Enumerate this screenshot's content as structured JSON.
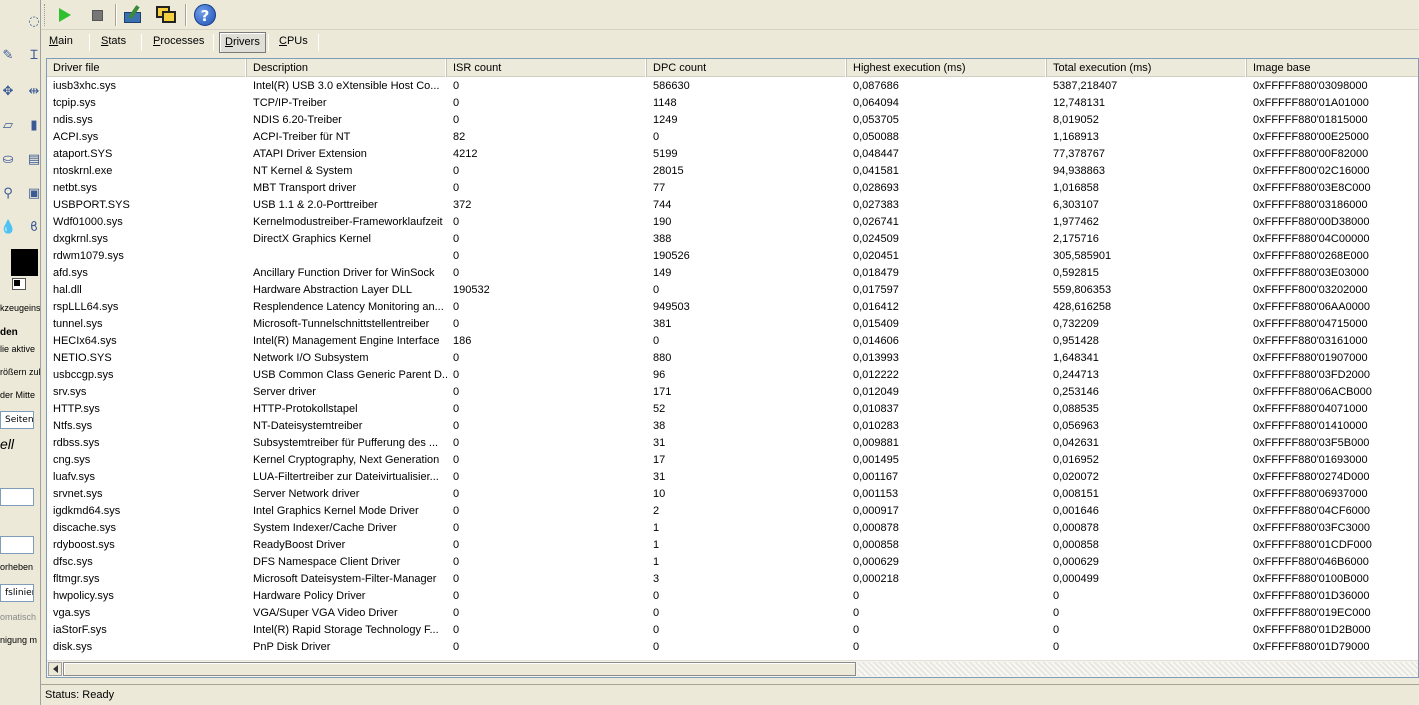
{
  "left_strip": {
    "texts": [
      "kzeugeins",
      "den",
      "lie aktive",
      "rößern zul",
      "der Mitte",
      "ell",
      "orheben",
      "fslinien",
      "omatisch",
      "nigung m"
    ],
    "box_texts": [
      "Seitenv"
    ]
  },
  "toolbar": {
    "buttons": [
      {
        "name": "start-monitor-button",
        "icon": "play-icon"
      },
      {
        "name": "stop-monitor-button",
        "icon": "stop-icon"
      },
      {
        "name": "tools-button",
        "icon": "tools-icon"
      },
      {
        "name": "window-button",
        "icon": "windows-icon"
      },
      {
        "name": "help-button",
        "icon": "help-icon",
        "glyph": "?"
      }
    ]
  },
  "tabs": [
    {
      "label": "Main",
      "accel": "M",
      "rest": "ain",
      "active": false
    },
    {
      "label": "Stats",
      "accel": "S",
      "rest": "tats",
      "active": false
    },
    {
      "label": "Processes",
      "accel": "P",
      "rest": "rocesses",
      "active": false
    },
    {
      "label": "Drivers",
      "accel": "D",
      "rest": "rivers",
      "active": true
    },
    {
      "label": "CPUs",
      "accel": "C",
      "rest": "PUs",
      "active": false
    }
  ],
  "table": {
    "columns": [
      "Driver file",
      "Description",
      "ISR count",
      "DPC count",
      "Highest execution (ms)",
      "Total execution (ms)",
      "Image base"
    ],
    "rows": [
      [
        "iusb3xhc.sys",
        "Intel(R) USB 3.0 eXtensible Host Co...",
        "0",
        "586630",
        "0,087686",
        "5387,218407",
        "0xFFFFF880'03098000"
      ],
      [
        "tcpip.sys",
        "TCP/IP-Treiber",
        "0",
        "1148",
        "0,064094",
        "12,748131",
        "0xFFFFF880'01A01000"
      ],
      [
        "ndis.sys",
        "NDIS 6.20-Treiber",
        "0",
        "1249",
        "0,053705",
        "8,019052",
        "0xFFFFF880'01815000"
      ],
      [
        "ACPI.sys",
        "ACPI-Treiber für NT",
        "82",
        "0",
        "0,050088",
        "1,168913",
        "0xFFFFF880'00E25000"
      ],
      [
        "ataport.SYS",
        "ATAPI Driver Extension",
        "4212",
        "5199",
        "0,048447",
        "77,378767",
        "0xFFFFF880'00F82000"
      ],
      [
        "ntoskrnl.exe",
        "NT Kernel & System",
        "0",
        "28015",
        "0,041581",
        "94,938863",
        "0xFFFFF800'02C16000"
      ],
      [
        "netbt.sys",
        "MBT Transport driver",
        "0",
        "77",
        "0,028693",
        "1,016858",
        "0xFFFFF880'03E8C000"
      ],
      [
        "USBPORT.SYS",
        "USB 1.1 & 2.0-Porttreiber",
        "372",
        "744",
        "0,027383",
        "6,303107",
        "0xFFFFF880'03186000"
      ],
      [
        "Wdf01000.sys",
        "Kernelmodustreiber-Frameworklaufzeit",
        "0",
        "190",
        "0,026741",
        "1,977462",
        "0xFFFFF880'00D38000"
      ],
      [
        "dxgkrnl.sys",
        "DirectX Graphics Kernel",
        "0",
        "388",
        "0,024509",
        "2,175716",
        "0xFFFFF880'04C00000"
      ],
      [
        "rdwm1079.sys",
        "",
        "0",
        "190526",
        "0,020451",
        "305,585901",
        "0xFFFFF880'0268E000"
      ],
      [
        "afd.sys",
        "Ancillary Function Driver for WinSock",
        "0",
        "149",
        "0,018479",
        "0,592815",
        "0xFFFFF880'03E03000"
      ],
      [
        "hal.dll",
        "Hardware Abstraction Layer DLL",
        "190532",
        "0",
        "0,017597",
        "559,806353",
        "0xFFFFF800'03202000"
      ],
      [
        "rspLLL64.sys",
        "Resplendence Latency Monitoring an...",
        "0",
        "949503",
        "0,016412",
        "428,616258",
        "0xFFFFF880'06AA0000"
      ],
      [
        "tunnel.sys",
        "Microsoft-Tunnelschnittstellentreiber",
        "0",
        "381",
        "0,015409",
        "0,732209",
        "0xFFFFF880'04715000"
      ],
      [
        "HECIx64.sys",
        "Intel(R) Management Engine Interface",
        "186",
        "0",
        "0,014606",
        "0,951428",
        "0xFFFFF880'03161000"
      ],
      [
        "NETIO.SYS",
        "Network I/O Subsystem",
        "0",
        "880",
        "0,013993",
        "1,648341",
        "0xFFFFF880'01907000"
      ],
      [
        "usbccgp.sys",
        "USB Common Class Generic Parent D...",
        "0",
        "96",
        "0,012222",
        "0,244713",
        "0xFFFFF880'03FD2000"
      ],
      [
        "srv.sys",
        "Server driver",
        "0",
        "171",
        "0,012049",
        "0,253146",
        "0xFFFFF880'06ACB000"
      ],
      [
        "HTTP.sys",
        "HTTP-Protokollstapel",
        "0",
        "52",
        "0,010837",
        "0,088535",
        "0xFFFFF880'04071000"
      ],
      [
        "Ntfs.sys",
        "NT-Dateisystemtreiber",
        "0",
        "38",
        "0,010283",
        "0,056963",
        "0xFFFFF880'01410000"
      ],
      [
        "rdbss.sys",
        "Subsystemtreiber für Pufferung des ...",
        "0",
        "31",
        "0,009881",
        "0,042631",
        "0xFFFFF880'03F5B000"
      ],
      [
        "cng.sys",
        "Kernel Cryptography, Next Generation",
        "0",
        "17",
        "0,001495",
        "0,016952",
        "0xFFFFF880'01693000"
      ],
      [
        "luafv.sys",
        "LUA-Filtertreiber zur Dateivirtualisier...",
        "0",
        "31",
        "0,001167",
        "0,020072",
        "0xFFFFF880'0274D000"
      ],
      [
        "srvnet.sys",
        "Server Network driver",
        "0",
        "10",
        "0,001153",
        "0,008151",
        "0xFFFFF880'06937000"
      ],
      [
        "igdkmd64.sys",
        "Intel Graphics Kernel Mode Driver",
        "0",
        "2",
        "0,000917",
        "0,001646",
        "0xFFFFF880'04CF6000"
      ],
      [
        "discache.sys",
        "System Indexer/Cache Driver",
        "0",
        "1",
        "0,000878",
        "0,000878",
        "0xFFFFF880'03FC3000"
      ],
      [
        "rdyboost.sys",
        "ReadyBoost Driver",
        "0",
        "1",
        "0,000858",
        "0,000858",
        "0xFFFFF880'01CDF000"
      ],
      [
        "dfsc.sys",
        "DFS Namespace Client Driver",
        "0",
        "1",
        "0,000629",
        "0,000629",
        "0xFFFFF880'046B6000"
      ],
      [
        "fltmgr.sys",
        "Microsoft Dateisystem-Filter-Manager",
        "0",
        "3",
        "0,000218",
        "0,000499",
        "0xFFFFF880'0100B000"
      ],
      [
        "hwpolicy.sys",
        "Hardware Policy Driver",
        "0",
        "0",
        "0",
        "0",
        "0xFFFFF880'01D36000"
      ],
      [
        "vga.sys",
        "VGA/Super VGA Video Driver",
        "0",
        "0",
        "0",
        "0",
        "0xFFFFF880'019EC000"
      ],
      [
        "iaStorF.sys",
        "Intel(R) Rapid Storage Technology F...",
        "0",
        "0",
        "0",
        "0",
        "0xFFFFF880'01D2B000"
      ],
      [
        "disk.sys",
        "PnP Disk Driver",
        "0",
        "0",
        "0",
        "0",
        "0xFFFFF880'01D79000"
      ]
    ]
  },
  "status": {
    "text": "Status: Ready"
  },
  "colors": {
    "window_bg": "#ece9d8",
    "list_bg": "#ffffff",
    "play_green": "#2fbf2f",
    "help_blue": "#1e4fb4"
  }
}
